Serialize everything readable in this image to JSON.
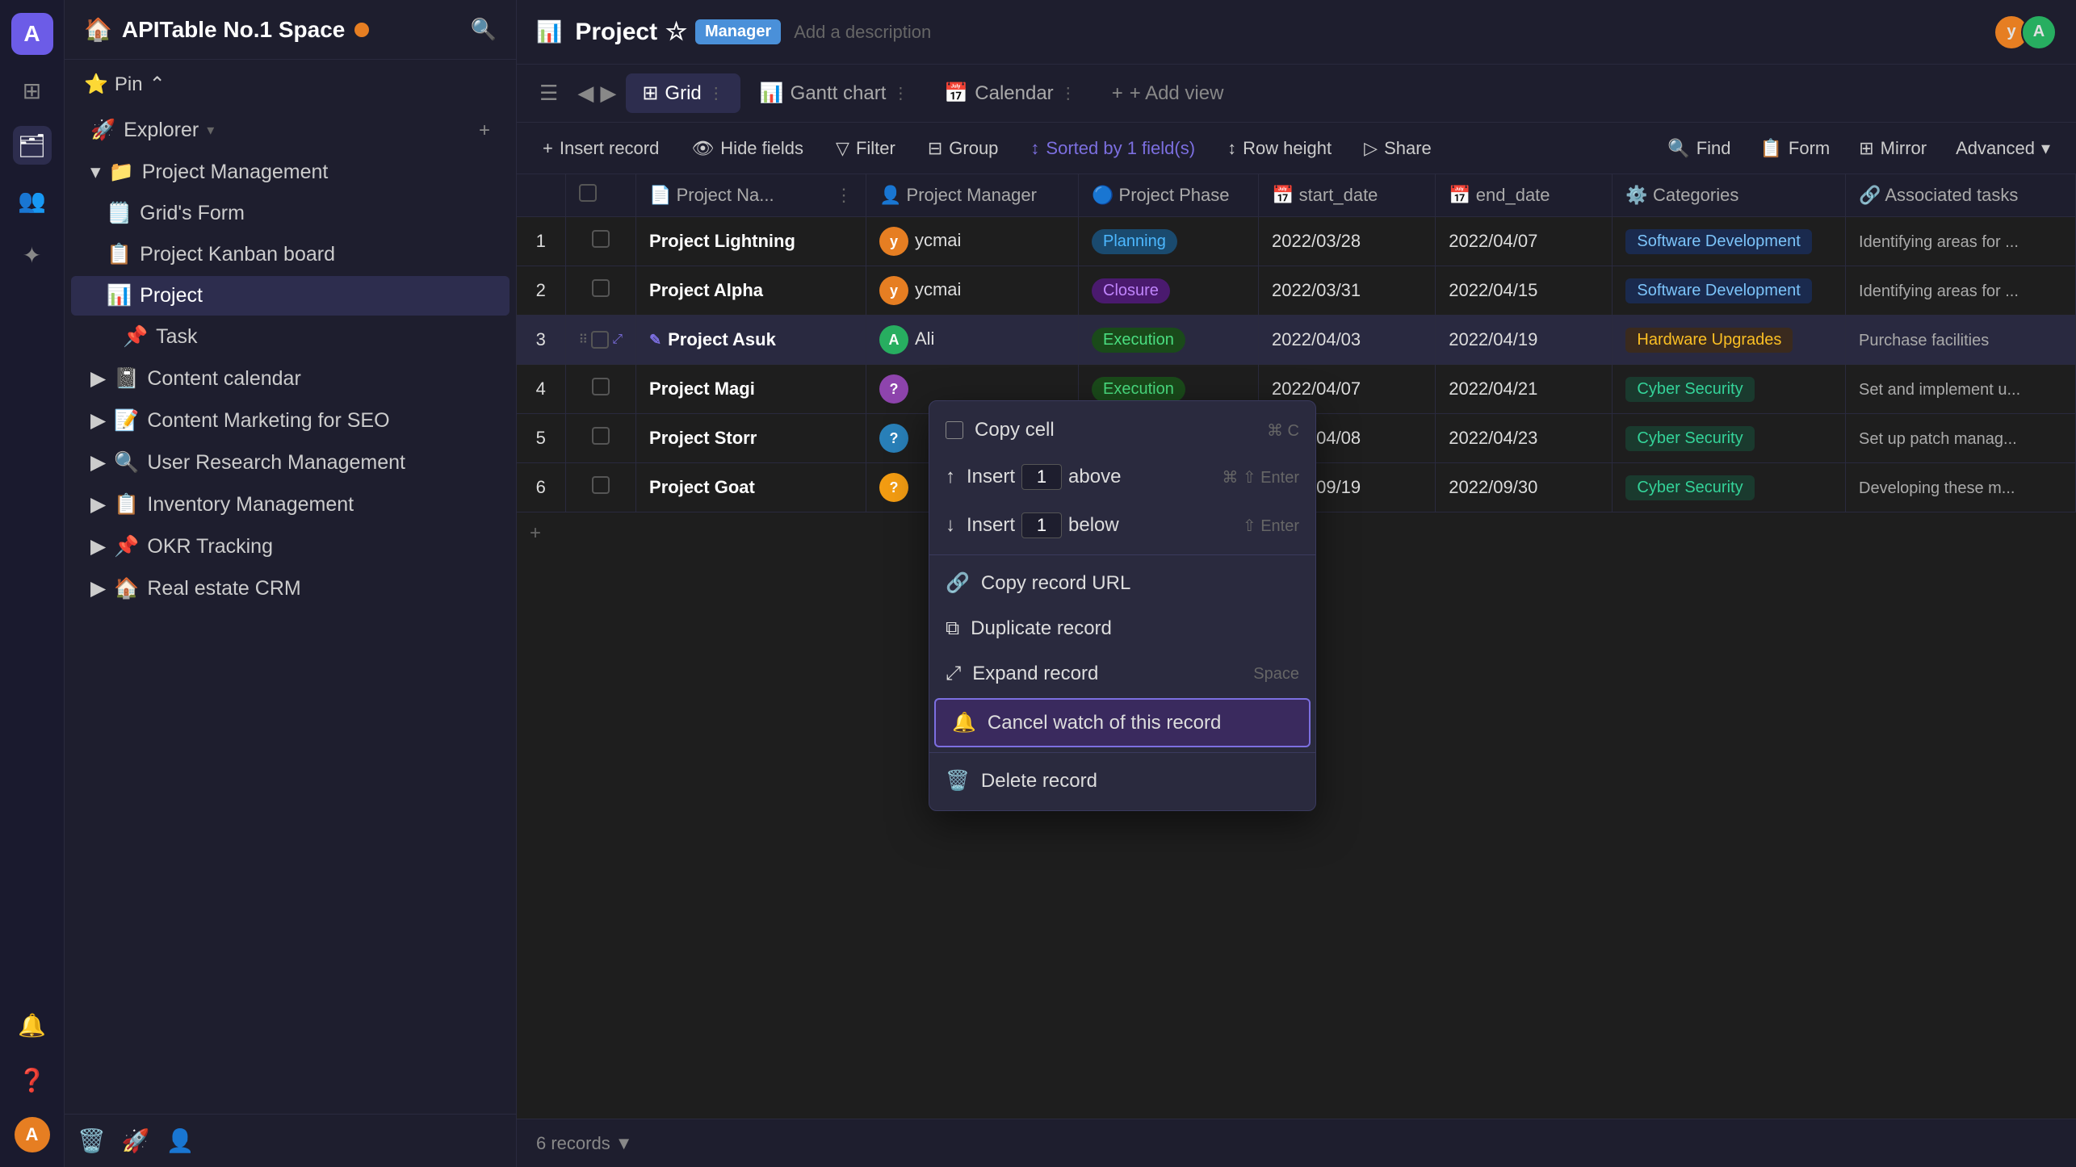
{
  "app": {
    "initial": "A",
    "space_name": "APITable No.1 Space",
    "space_dot_color": "#e67e22"
  },
  "sidebar": {
    "pin_label": "Pin",
    "explorer_label": "Explorer",
    "new_button": "+",
    "items": [
      {
        "id": "project-management",
        "icon": "📁",
        "label": "Project Management",
        "indent": 0,
        "has_chevron": true,
        "chevron_open": true
      },
      {
        "id": "grids-form",
        "icon": "🗒️",
        "label": "Grid's Form",
        "indent": 1
      },
      {
        "id": "project-kanban",
        "icon": "📋",
        "label": "Project Kanban board",
        "indent": 1
      },
      {
        "id": "project",
        "icon": "📊",
        "label": "Project",
        "indent": 1,
        "active": true
      },
      {
        "id": "task",
        "icon": "📌",
        "label": "Task",
        "indent": 2
      },
      {
        "id": "content-calendar",
        "icon": "📓",
        "label": "Content calendar",
        "indent": 0,
        "has_chevron": true
      },
      {
        "id": "content-marketing",
        "icon": "📝",
        "label": "Content Marketing for SEO",
        "indent": 0,
        "has_chevron": true
      },
      {
        "id": "user-research",
        "icon": "🔍",
        "label": "User Research Management",
        "indent": 0,
        "has_chevron": true
      },
      {
        "id": "inventory",
        "icon": "📋",
        "label": "Inventory Management",
        "indent": 0,
        "has_chevron": true
      },
      {
        "id": "okr-tracking",
        "icon": "📌",
        "label": "OKR Tracking",
        "indent": 0,
        "has_chevron": true
      },
      {
        "id": "real-estate",
        "icon": "🏠",
        "label": "Real estate CRM",
        "indent": 0,
        "has_chevron": true
      }
    ],
    "bottom_icons": [
      "🗑️",
      "🚀",
      "👤"
    ]
  },
  "project": {
    "title": "Project",
    "manager_badge": "Manager",
    "description": "Add a description"
  },
  "views": [
    {
      "id": "grid",
      "icon": "⊞",
      "label": "Grid",
      "active": true
    },
    {
      "id": "gantt",
      "icon": "📊",
      "label": "Gantt chart",
      "active": false
    },
    {
      "id": "calendar",
      "icon": "📅",
      "label": "Calendar",
      "active": false
    }
  ],
  "add_view_label": "+ Add view",
  "toolbar": {
    "insert_record": "Insert record",
    "hide_fields": "Hide fields",
    "filter": "Filter",
    "group": "Group",
    "sorted_by": "Sorted by 1 field(s)",
    "row_height": "Row height",
    "share": "Share",
    "find": "Find",
    "form": "Form",
    "mirror": "Mirror",
    "advanced": "Advanced"
  },
  "table": {
    "columns": [
      {
        "id": "row-num",
        "label": ""
      },
      {
        "id": "checkbox",
        "label": ""
      },
      {
        "id": "project-name",
        "label": "Project Na...",
        "icon": "📄"
      },
      {
        "id": "project-manager",
        "label": "Project Manager",
        "icon": "👤"
      },
      {
        "id": "project-phase",
        "label": "Project Phase",
        "icon": "🔵"
      },
      {
        "id": "start-date",
        "label": "start_date",
        "icon": "📅"
      },
      {
        "id": "end-date",
        "label": "end_date",
        "icon": "📅"
      },
      {
        "id": "categories",
        "label": "Categories",
        "icon": "⚙️"
      },
      {
        "id": "associated-tasks",
        "label": "Associated tasks",
        "icon": "🔗"
      }
    ],
    "rows": [
      {
        "num": 1,
        "project_name": "Project Lightning",
        "manager": "ycmai",
        "manager_color": "#e67e22",
        "phase": "Planning",
        "phase_class": "phase-planning",
        "start_date": "2022/03/28",
        "end_date": "2022/04/07",
        "category": "Software Development",
        "category_class": "category-software",
        "tasks": "Identifying areas for ..."
      },
      {
        "num": 2,
        "project_name": "Project Alpha",
        "manager": "ycmai",
        "manager_color": "#e67e22",
        "phase": "Closure",
        "phase_class": "phase-closure",
        "start_date": "2022/03/31",
        "end_date": "2022/04/15",
        "category": "Software Development",
        "category_class": "category-software",
        "tasks": "Identifying areas for ..."
      },
      {
        "num": 3,
        "project_name": "Project Asuk",
        "manager": "Ali",
        "manager_color": "#27ae60",
        "phase": "Execution",
        "phase_class": "phase-execution",
        "start_date": "2022/04/03",
        "end_date": "2022/04/19",
        "category": "Hardware Upgrades",
        "category_class": "category-hardware",
        "tasks": "Purchase facilities"
      },
      {
        "num": 4,
        "project_name": "Project Magi",
        "manager": "",
        "manager_color": "#8e44ad",
        "phase": "Execution",
        "phase_class": "phase-execution",
        "start_date": "2022/04/07",
        "end_date": "2022/04/21",
        "category": "Cyber Security",
        "category_class": "category-cyber",
        "tasks": "Set and implement u..."
      },
      {
        "num": 5,
        "project_name": "Project Storr",
        "manager": "",
        "manager_color": "#2980b9",
        "phase": "Execution",
        "phase_class": "phase-execution",
        "start_date": "2022/04/08",
        "end_date": "2022/04/23",
        "category": "Cyber Security",
        "category_class": "category-cyber",
        "tasks": "Set up patch manag..."
      },
      {
        "num": 6,
        "project_name": "Project Goat",
        "manager": "",
        "manager_color": "#f39c12",
        "phase": "Execution",
        "phase_class": "phase-execution",
        "start_date": "2022/09/19",
        "end_date": "2022/09/30",
        "category": "Cyber Security",
        "category_class": "category-cyber",
        "tasks": "Developing these m..."
      }
    ]
  },
  "context_menu": {
    "items": [
      {
        "id": "copy-cell",
        "icon": "⬜",
        "label": "Copy cell",
        "shortcut": "⌘ C",
        "type": "action"
      },
      {
        "id": "insert-above",
        "icon": "↑",
        "label": "Insert",
        "count": "1",
        "direction": "above",
        "shortcut": "⌘ ⇧ Enter",
        "type": "insert"
      },
      {
        "id": "insert-below",
        "icon": "↓",
        "label": "Insert",
        "count": "1",
        "direction": "below",
        "shortcut": "⇧ Enter",
        "type": "insert"
      },
      {
        "id": "divider1",
        "type": "divider"
      },
      {
        "id": "copy-url",
        "icon": "🔗",
        "label": "Copy record URL",
        "type": "action"
      },
      {
        "id": "duplicate",
        "icon": "⧉",
        "label": "Duplicate record",
        "type": "action"
      },
      {
        "id": "expand",
        "icon": "⤢",
        "label": "Expand record",
        "shortcut": "Space",
        "type": "action"
      },
      {
        "id": "cancel-watch",
        "icon": "🔔",
        "label": "Cancel watch of this record",
        "type": "action",
        "highlighted": true
      },
      {
        "id": "divider2",
        "type": "divider"
      },
      {
        "id": "delete",
        "icon": "🗑️",
        "label": "Delete record",
        "type": "action"
      }
    ]
  },
  "bottom_bar": {
    "records_label": "6 records",
    "records_icon": "▼"
  }
}
